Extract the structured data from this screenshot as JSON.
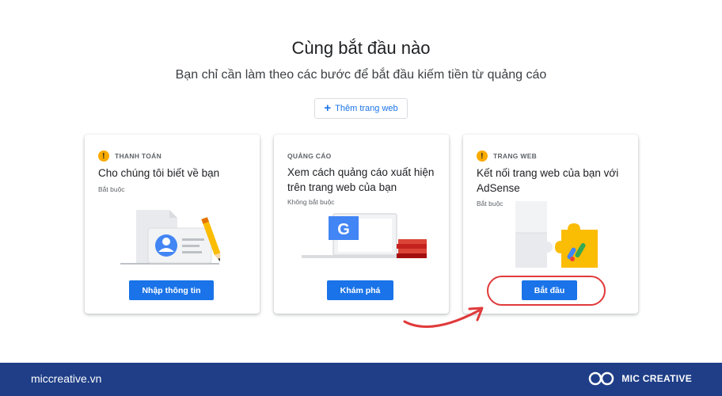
{
  "header": {
    "title": "Cùng bắt đầu nào",
    "subtitle": "Bạn chỉ cần làm theo các bước để bắt đầu kiếm tiền từ quảng cáo"
  },
  "add_site_button": {
    "label": "Thêm trang web",
    "icon": "plus-icon"
  },
  "cards": [
    {
      "category": "THANH TOÁN",
      "has_warning": true,
      "title": "Cho chúng tôi biết về bạn",
      "requirement": "Bắt buộc",
      "button": "Nhập thông tin"
    },
    {
      "category": "QUẢNG CÁO",
      "has_warning": false,
      "title": "Xem cách quảng cáo xuất hiện trên trang web của bạn",
      "requirement": "Không bắt buộc",
      "button": "Khám phá"
    },
    {
      "category": "TRANG WEB",
      "has_warning": true,
      "title": "Kết nối trang web của bạn với AdSense",
      "requirement": "Bắt buộc",
      "button": "Bắt đầu"
    }
  ],
  "annotation": {
    "color": "#e03a3a"
  },
  "colors": {
    "primary": "#1a73e8",
    "warning": "#f9ab00",
    "footer_bg": "#1f3e87"
  },
  "footer": {
    "url": "miccreative.vn",
    "brand": "MIC CREATIVE"
  }
}
